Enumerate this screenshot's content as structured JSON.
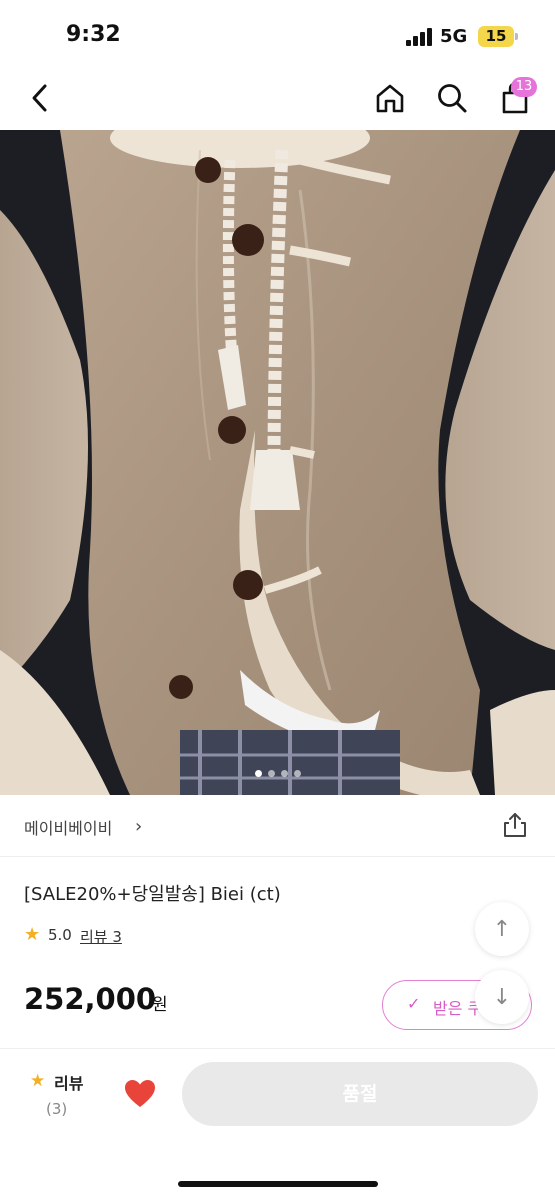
{
  "status_bar": {
    "time": "9:32",
    "network": "5G",
    "battery": "15"
  },
  "nav": {
    "back_icon": "chevron-left-icon",
    "home_icon": "home-icon",
    "search_icon": "search-icon",
    "cart_icon": "shopping-bag-icon",
    "cart_count": "13"
  },
  "gallery": {
    "image_count": 4,
    "active_index": 1
  },
  "shop": {
    "name": "메이비베이비",
    "chevron": "›"
  },
  "product": {
    "title": "[SALE20%+당일발송] Biei (ct)",
    "rating": "5.0",
    "review_link": "리뷰 3",
    "price": "252,000",
    "currency": "원"
  },
  "coupon": {
    "check": "✓",
    "label": "받은 쿠"
  },
  "fab": {
    "up": "↑",
    "down": "↓"
  },
  "bottom_bar": {
    "review_label": "리뷰",
    "review_count": "(3)",
    "buy_button": "품절"
  },
  "colors": {
    "accent_pink": "#e573d9",
    "star": "#f2b024",
    "heart": "#e8443a",
    "disabled_button": "#e9e9e9"
  }
}
